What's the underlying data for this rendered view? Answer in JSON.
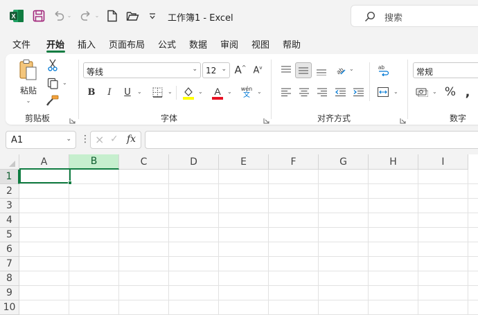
{
  "window": {
    "title": "工作簿1  -  Excel"
  },
  "search": {
    "placeholder": "搜索"
  },
  "ribbon_tabs": [
    "文件",
    "开始",
    "插入",
    "页面布局",
    "公式",
    "数据",
    "审阅",
    "视图",
    "帮助"
  ],
  "active_tab": "开始",
  "clipboard": {
    "paste_label": "粘贴",
    "group_label": "剪贴板"
  },
  "font": {
    "name": "等线",
    "size": "12",
    "group_label": "字体",
    "bold": "B",
    "italic": "I",
    "underline": "U",
    "phonetic_top": "wén",
    "phonetic_bottom": "文"
  },
  "alignment": {
    "group_label": "对齐方式"
  },
  "number": {
    "format": "常规",
    "group_label": "数字",
    "percent": "%"
  },
  "formula_bar": {
    "name_box": "A1",
    "fx": "fx",
    "formula": ""
  },
  "columns": [
    "A",
    "B",
    "C",
    "D",
    "E",
    "F",
    "G",
    "H",
    "I"
  ],
  "rows": [
    "1",
    "2",
    "3",
    "4",
    "5",
    "6",
    "7",
    "8",
    "9",
    "10"
  ],
  "selected_column": "B",
  "active_cell": "A1",
  "colors": {
    "accent": "#107c41",
    "selected_header": "#c6efce",
    "highlight_yellow": "#ffff00",
    "font_red": "#e81123"
  }
}
